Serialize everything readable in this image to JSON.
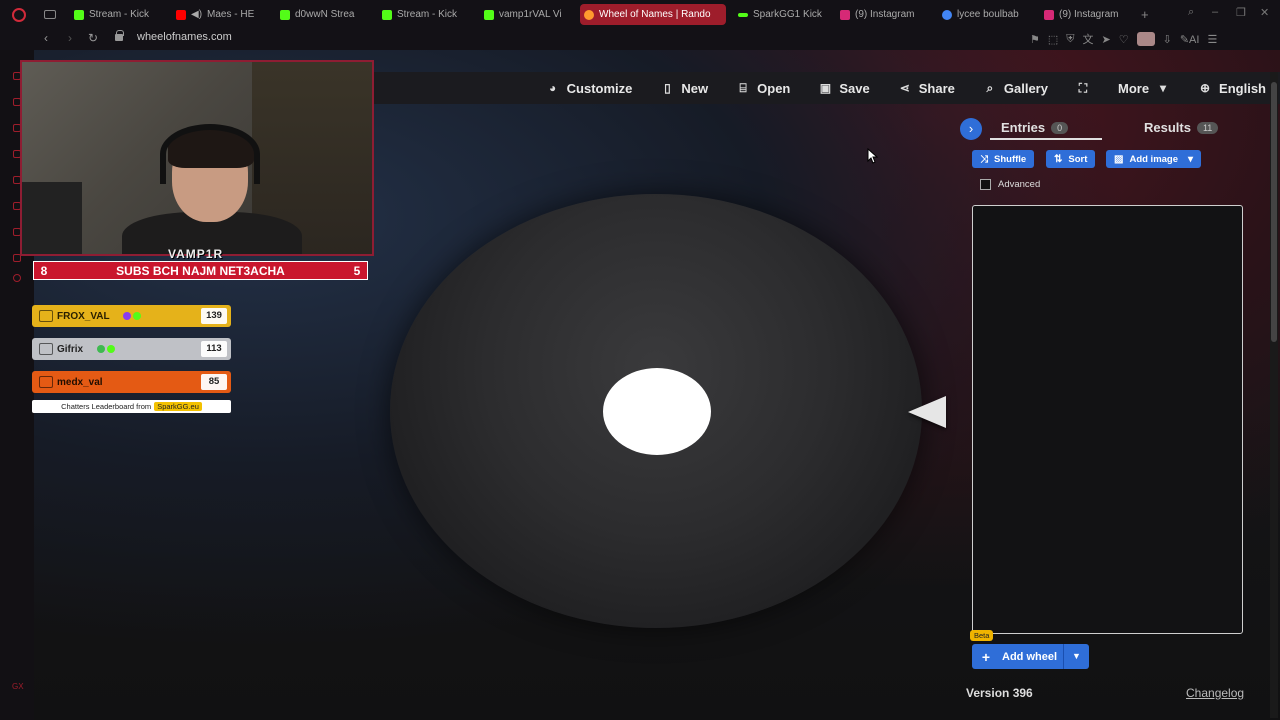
{
  "browser": {
    "tabs": [
      {
        "label": "Stream - Kick",
        "favicon_color": "#53fc18"
      },
      {
        "label": "Maes - HE",
        "favicon_color": "#ff0000"
      },
      {
        "label": "d0wwN Strea",
        "favicon_color": "#53fc18"
      },
      {
        "label": "Stream - Kick",
        "favicon_color": "#53fc18"
      },
      {
        "label": "vamp1rVAL Vi",
        "favicon_color": "#53fc18"
      },
      {
        "label": "Wheel of Names | Rando",
        "favicon_color": "#ff9a2e",
        "active": true
      },
      {
        "label": "SparkGG1 Kick",
        "favicon_color": "#53fc18"
      },
      {
        "label": "(9) Instagram",
        "favicon_color": "#d62976"
      },
      {
        "label": "lycee boulbab",
        "favicon_color": "#4285f4"
      },
      {
        "label": "(9) Instagram",
        "favicon_color": "#d62976"
      }
    ],
    "url": "wheelofnames.com"
  },
  "overlay": {
    "streamer_name": "VAMP1R",
    "subs_goal": {
      "left": "8",
      "text": "SUBS BCH NAJM NET3ACHA",
      "right": "5"
    },
    "leaderboard": [
      {
        "name": "FROX_VAL",
        "score": "139"
      },
      {
        "name": "Gifrix",
        "score": "113"
      },
      {
        "name": "medx_val",
        "score": "85"
      }
    ],
    "leaderboard_footer": "Chatters Leaderboard from",
    "leaderboard_brand": "SparkGG.eu"
  },
  "nav": {
    "customize": "Customize",
    "new": "New",
    "open": "Open",
    "save": "Save",
    "share": "Share",
    "gallery": "Gallery",
    "more": "More",
    "language": "English"
  },
  "panel": {
    "entries_label": "Entries",
    "entries_count": "0",
    "results_label": "Results",
    "results_count": "11",
    "shuffle": "Shuffle",
    "sort": "Sort",
    "add_image": "Add image",
    "advanced": "Advanced",
    "beta": "Beta",
    "add_wheel": "Add wheel",
    "version": "Version 396",
    "changelog": "Changelog"
  },
  "colors": {
    "accent_blue": "#2f6ed8",
    "brand_red": "#c9162d"
  }
}
